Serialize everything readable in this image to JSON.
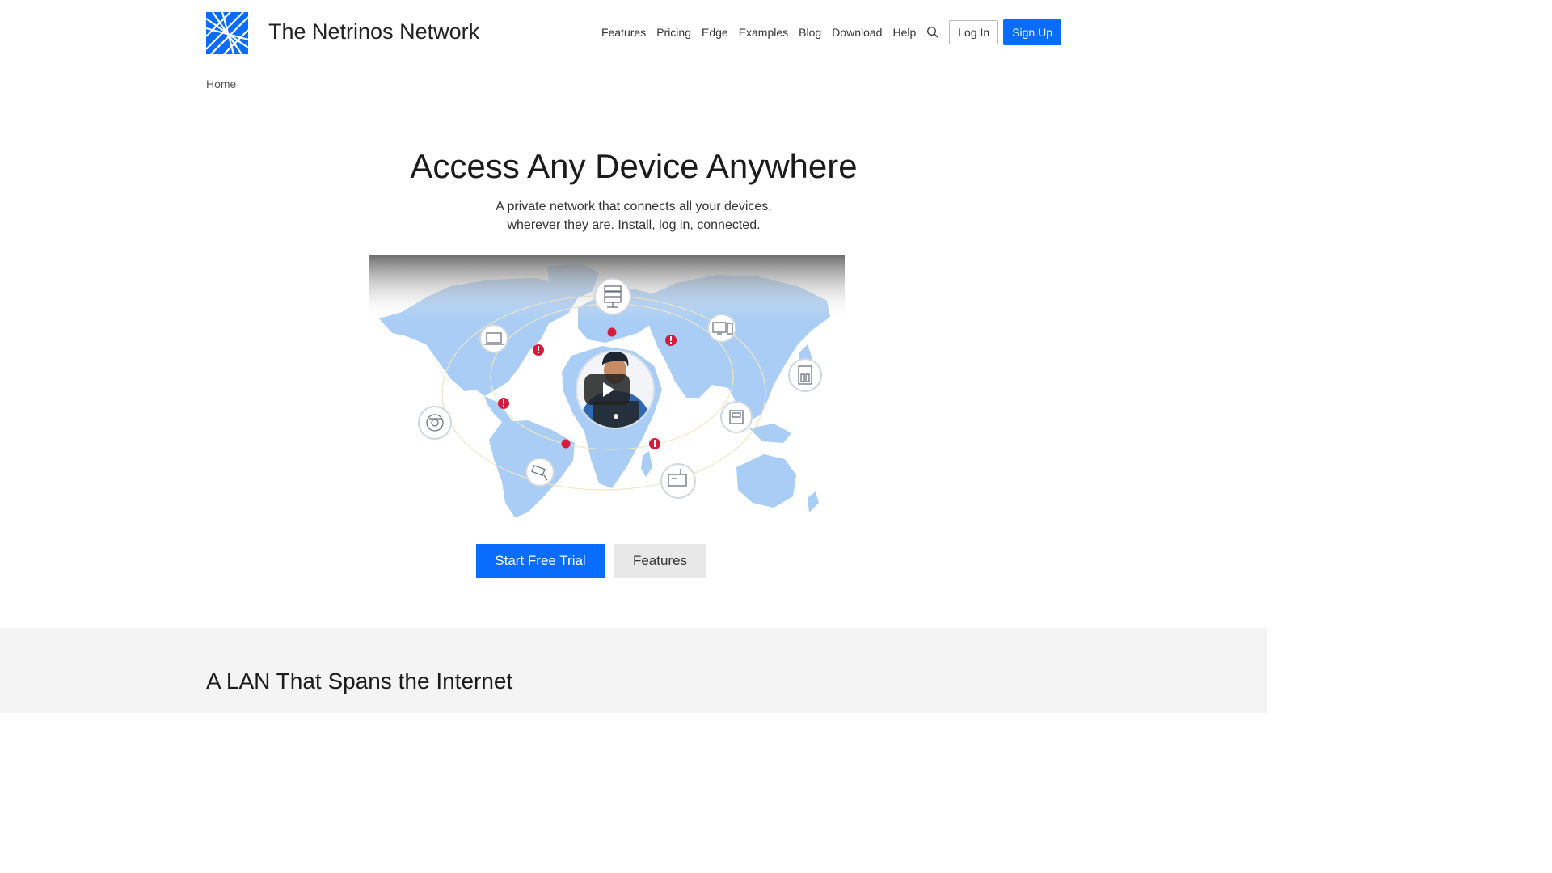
{
  "site": {
    "title": "The Netrinos Network"
  },
  "nav": {
    "links": [
      "Features",
      "Pricing",
      "Edge",
      "Examples",
      "Blog",
      "Download",
      "Help"
    ],
    "login": "Log In",
    "signup": "Sign Up"
  },
  "breadcrumb": "Home",
  "hero": {
    "title": "Access Any Device Anywhere",
    "subtitle_line1": "A private network that connects all your devices,",
    "subtitle_line2": "wherever they are. Install, log in, connected."
  },
  "cta": {
    "primary": "Start Free Trial",
    "secondary": "Features"
  },
  "section2": {
    "title": "A LAN That Spans the Internet"
  },
  "colors": {
    "accent": "#0a6cff",
    "map": "#a9cdf4",
    "alert": "#d81b3c",
    "section_bg": "#f4f4f4"
  },
  "icons": [
    "netrinos-logo-icon",
    "search-icon",
    "play-icon",
    "server-icon",
    "laptop-icon",
    "desktop-icon",
    "nas-icon",
    "robot-vacuum-icon",
    "camera-icon",
    "router-icon",
    "thermostat-icon",
    "alert-icon"
  ]
}
